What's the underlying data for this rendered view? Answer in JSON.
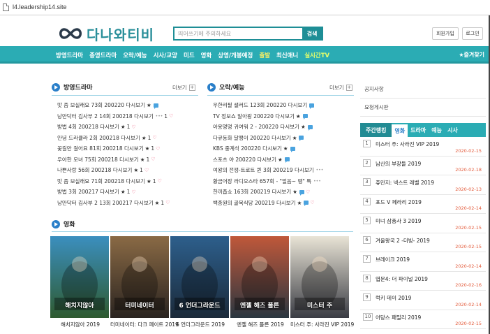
{
  "browser": {
    "url": "l4.leadership14.site"
  },
  "header": {
    "logo_text": "다나와티비",
    "search_placeholder": "띄어쓰기에 주의하세요",
    "search_button": "검색",
    "join_button": "회원가입",
    "login_button": "로그인"
  },
  "nav": {
    "items": [
      "방영드라마",
      "종영드라마",
      "오락/예능",
      "시사/교양",
      "미드",
      "영화",
      "상영/개봉예정",
      "출발",
      "최신애니",
      "실시간TV"
    ],
    "favorite": "★즐겨찾기"
  },
  "drama": {
    "title": "방영드라마",
    "more": "더보기",
    "items": [
      {
        "text": "맛 좀 보실래요 73회 200220 다시보기",
        "star": "★",
        "count": "",
        "icons": [
          "comment"
        ]
      },
      {
        "text": "낭만닥터 김사부 2 14회 200218 다시보기",
        "star": "",
        "count": "1",
        "icons": [
          "dots",
          "heart"
        ]
      },
      {
        "text": "방법 4회 200218 다시보기",
        "star": "★",
        "count": "1",
        "icons": [
          "heart"
        ]
      },
      {
        "text": "안녕 드라큘라 2회 200218 다시보기",
        "star": "★",
        "count": "1",
        "icons": [
          "heart"
        ]
      },
      {
        "text": "꽃길만 걸어요 81회 200218 다시보기",
        "star": "★",
        "count": "1",
        "icons": [
          "heart"
        ]
      },
      {
        "text": "우아한 모녀 75회 200218 다시보기",
        "star": "★",
        "count": "1",
        "icons": [
          "heart"
        ]
      },
      {
        "text": "나쁜사랑 56회 200218 다시보기",
        "star": "★",
        "count": "1",
        "icons": [
          "heart"
        ]
      },
      {
        "text": "맛 좀 보실래요 71회 200218 다시보기",
        "star": "★",
        "count": "1",
        "icons": [
          "heart"
        ]
      },
      {
        "text": "방법 3회 200217 다시보기",
        "star": "★",
        "count": "1",
        "icons": [
          "heart"
        ]
      },
      {
        "text": "낭만닥터 김사부 2 13회 200217 다시보기",
        "star": "★",
        "count": "1",
        "icons": [
          "heart"
        ]
      }
    ]
  },
  "variety": {
    "title": "오락/예능",
    "more": "더보기",
    "items": [
      {
        "text": "우한리필 샐러드 123회 200220 다시보기",
        "star": "",
        "count": "",
        "icons": [
          "comment"
        ]
      },
      {
        "text": "TV 정보쇼 알아왕 200220 다시보기",
        "star": "★",
        "count": "",
        "icons": [
          "comment"
        ]
      },
      {
        "text": "아용멍멍 귀여워 2 - 200220 다시보기",
        "star": "★",
        "count": "",
        "icons": [
          "comment"
        ]
      },
      {
        "text": "다큐동화 달팽이 200220 다시보기",
        "star": "★",
        "count": "",
        "icons": [
          "comment"
        ]
      },
      {
        "text": "KBS 중계석 200220 다시보기",
        "star": "★",
        "count": "",
        "icons": [
          "comment"
        ]
      },
      {
        "text": "스포츠 야 200220 다시보기",
        "star": "★",
        "count": "",
        "icons": [
          "comment"
        ]
      },
      {
        "text": "여왕의 전쟁-트로트 퀸 3회 200219 다시보기",
        "star": "",
        "count": "",
        "icons": [
          "dots"
        ]
      },
      {
        "text": "황금어장 라디오스타 657회 - \"얼음~ 땡\" 특",
        "star": "",
        "count": "",
        "icons": [
          "dots"
        ]
      },
      {
        "text": "한끼줍쇼 163회 200219 다시보기",
        "star": "★",
        "count": "",
        "icons": [
          "comment",
          "heart"
        ]
      },
      {
        "text": "백종원의 골목식당 200219 다시보기",
        "star": "★",
        "count": "",
        "icons": [
          "comment",
          "heart"
        ]
      }
    ]
  },
  "movies": {
    "title": "영화",
    "posters": [
      {
        "caption": "해치지않아 2019",
        "art": "해치지않아",
        "c1": "#3b8fbf",
        "c2": "#2e5a2f"
      },
      {
        "caption": "터미네이터: 다크 페이트 2019",
        "art": "터미네이터",
        "c1": "#8a6a45",
        "c2": "#2a2420"
      },
      {
        "caption": "6 언더그라운드 2019",
        "art": "6 언더그라운드",
        "c1": "#2d5f8c",
        "c2": "#1b2a3a"
      },
      {
        "caption": "엔젤 해즈 폴른 2019",
        "art": "엔젤 해즈 폴른",
        "c1": "#c0583a",
        "c2": "#2a3640"
      },
      {
        "caption": "미스터 주: 사라진 VIP 2019",
        "art": "미스터 주",
        "c1": "#e9e4d6",
        "c2": "#3a3c44"
      }
    ]
  },
  "sidebar": {
    "links": [
      "공지사항",
      "요청게시판"
    ],
    "rank_tabs": [
      "주간랭킹",
      "영화",
      "드라마",
      "예능",
      "시사"
    ],
    "ranking": [
      {
        "num": "1",
        "title": "미스터 주: 사라진 VIP 2019",
        "date": "2020-02-15"
      },
      {
        "num": "2",
        "title": "남산의 부장들 2019",
        "date": "2020-02-18"
      },
      {
        "num": "3",
        "title": "쥬만지: 넥스트 레벨 2019",
        "date": "2020-02-13"
      },
      {
        "num": "4",
        "title": "포드 V 페라리 2019",
        "date": "2020-02-14"
      },
      {
        "num": "5",
        "title": "미녀 삼총사 3 2019",
        "date": "2020-02-15"
      },
      {
        "num": "6",
        "title": "겨울왕국 2 -더빙- 2019",
        "date": "2020-02-15"
      },
      {
        "num": "7",
        "title": "브레이크 2019",
        "date": "2020-02-14"
      },
      {
        "num": "8",
        "title": "엽문4: 더 파이널 2019",
        "date": "2020-02-16"
      },
      {
        "num": "9",
        "title": "럭키 데이 2019",
        "date": "2020-02-14"
      },
      {
        "num": "10",
        "title": "어당스 패밀리 2019",
        "date": "2020-02-15"
      }
    ]
  },
  "colors": {
    "teal": "#2bacb4",
    "dark_teal": "#1e8e96",
    "blue_dot": "#2a7fc9",
    "date_red": "#e35a3a"
  }
}
